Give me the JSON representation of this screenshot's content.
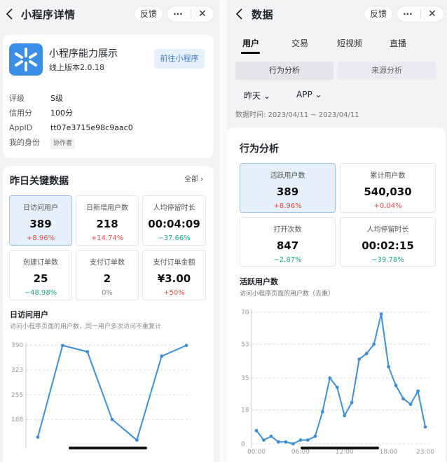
{
  "left": {
    "nav": {
      "title": "小程序详情",
      "feedback": "反馈",
      "more": "···",
      "close": "✕"
    },
    "app": {
      "name": "小程序能力展示",
      "version": "线上版本2.0.18",
      "cta": "前往小程序",
      "info": [
        {
          "k": "评级",
          "v": "S级"
        },
        {
          "k": "信用分",
          "v": "100分"
        },
        {
          "k": "AppID",
          "v": "tt07e3715e98c9aac0"
        },
        {
          "k": "我的身份",
          "v": "协作者"
        }
      ]
    },
    "kpi_section": {
      "title": "昨日关键数据",
      "all": "全部",
      "cards": [
        {
          "label": "日访问用户",
          "value": "389",
          "change": "+8.96%",
          "trend": "up"
        },
        {
          "label": "日新增用户数",
          "value": "218",
          "change": "+14.74%",
          "trend": "up"
        },
        {
          "label": "人均停留时长",
          "value": "00:04:09",
          "change": "−37.66%",
          "trend": "down"
        },
        {
          "label": "创建订单数",
          "value": "25",
          "change": "−48.98%",
          "trend": "down"
        },
        {
          "label": "支付订单数",
          "value": "2",
          "change": "0%",
          "trend": "flat"
        },
        {
          "label": "支付订单金额",
          "value": "¥3.00",
          "change": "+50%",
          "trend": "up"
        }
      ]
    },
    "chart_title": "日访问用户",
    "chart_sub": "访问小程序页面的用户数，同一用户多次访问不重复计",
    "chart_data": {
      "type": "line",
      "title": "日访问用户",
      "y_ticks": [
        "390",
        "323",
        "255",
        "188"
      ],
      "ylim": [
        120,
        390
      ],
      "x": [
        0,
        1,
        2,
        3,
        4,
        5,
        6
      ],
      "values": [
        140,
        389,
        372,
        188,
        132,
        360,
        389
      ],
      "grid": true,
      "color": "#3d8fd6"
    }
  },
  "right": {
    "nav": {
      "title": "数据",
      "feedback": "反馈",
      "more": "···",
      "close": "✕"
    },
    "tabs": [
      "用户",
      "交易",
      "短视频",
      "直播"
    ],
    "segments": [
      "行为分析",
      "来源分析"
    ],
    "filters": [
      "昨天",
      "APP"
    ],
    "data_time": "数据时间: 2023/04/11 ~ 2023/04/11",
    "section_title": "行为分析",
    "cards": [
      {
        "label": "活跃用户数",
        "value": "389",
        "change": "+8.96%",
        "trend": "up"
      },
      {
        "label": "累计用户数",
        "value": "540,030",
        "change": "+0.04%",
        "trend": "up"
      },
      {
        "label": "打开次数",
        "value": "847",
        "change": "−2.87%",
        "trend": "down"
      },
      {
        "label": "人均停留时长",
        "value": "00:02:15",
        "change": "−39.78%",
        "trend": "down"
      }
    ],
    "chart_title": "活跃用户数",
    "chart_sub": "访问小程序页面的用户数（去重）",
    "chart_data": {
      "type": "line",
      "title": "活跃用户数",
      "y_ticks": [
        "70",
        "53",
        "35",
        "18",
        "0"
      ],
      "x_ticks": [
        "00:00",
        "06:00",
        "12:00",
        "18:00",
        "23:00"
      ],
      "ylim": [
        0,
        70
      ],
      "x": [
        0,
        1,
        2,
        3,
        4,
        5,
        6,
        7,
        8,
        9,
        10,
        11,
        12,
        13,
        14,
        15,
        16,
        17,
        18,
        19,
        20,
        21,
        22,
        23
      ],
      "values": [
        7,
        2,
        4,
        1,
        1,
        0,
        2,
        2,
        4,
        17,
        35,
        30,
        15,
        22,
        45,
        48,
        53,
        69,
        41,
        31,
        24,
        21,
        28,
        9
      ],
      "grid": true,
      "color": "#3d8fd6"
    }
  },
  "colors": {
    "accent": "#3d8fd6",
    "up": "#e34d4d",
    "down": "#22a88c"
  }
}
